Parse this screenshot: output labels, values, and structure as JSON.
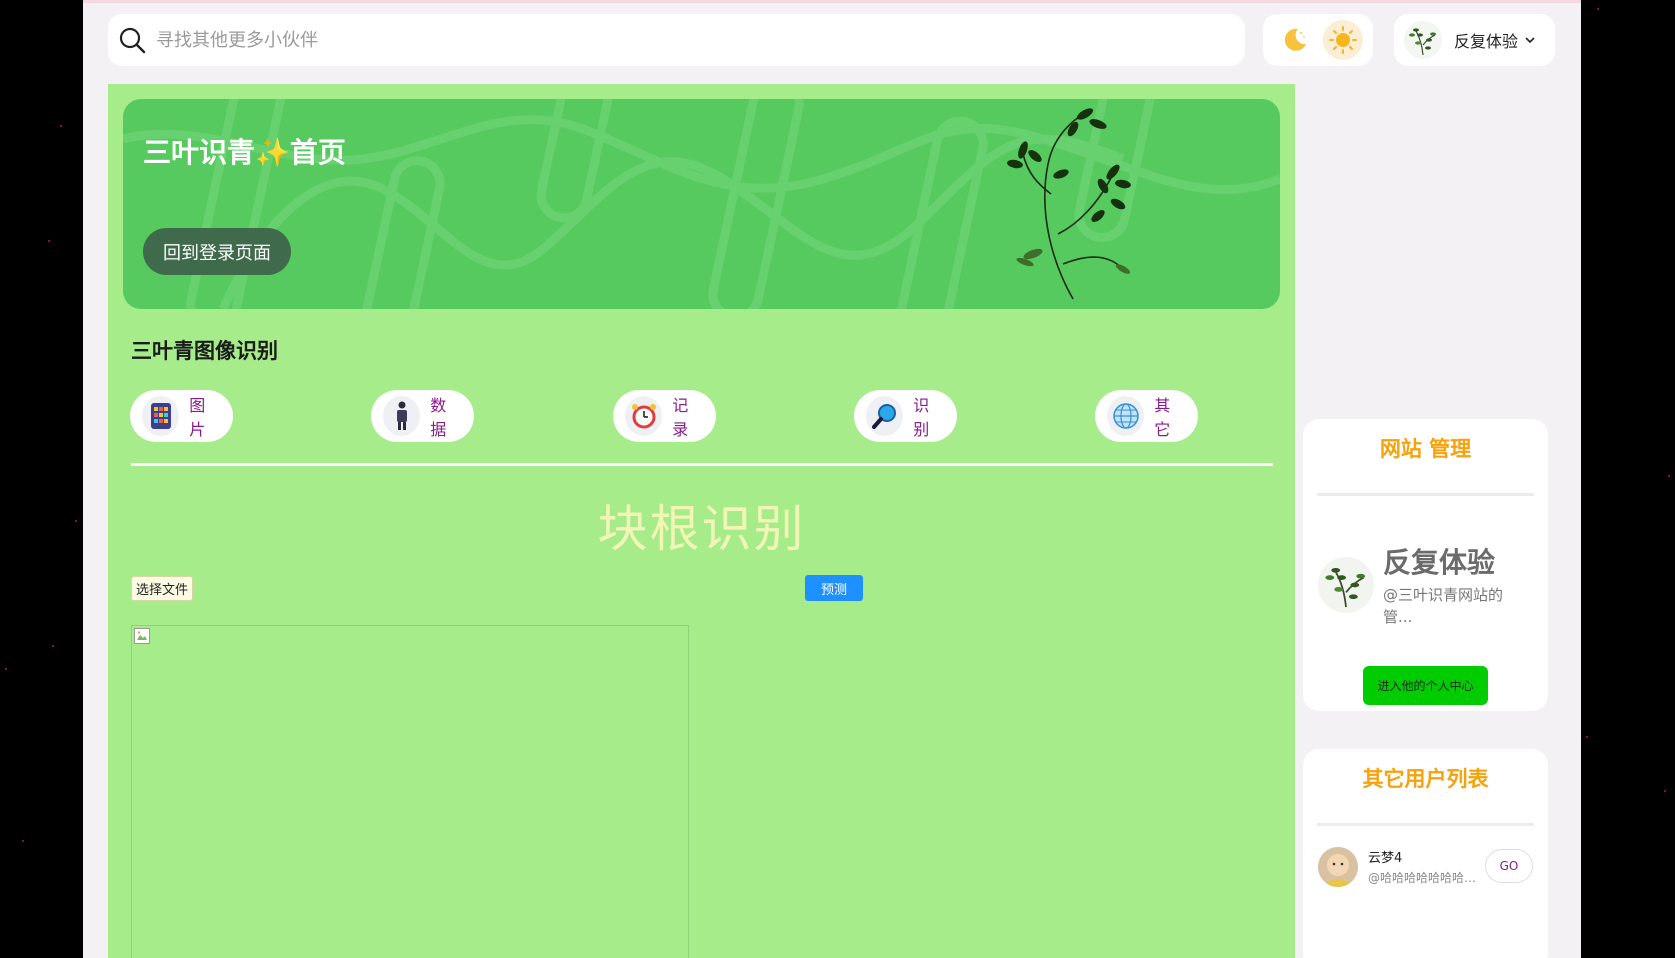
{
  "header": {
    "search_placeholder": "寻找其他更多小伙伴",
    "username": "反复体验"
  },
  "hero": {
    "title": "三叶识青✨首页",
    "back_button": "回到登录页面"
  },
  "section_title": "三叶青图像识别",
  "categories": [
    {
      "label": "图片",
      "icon": "calculator-icon"
    },
    {
      "label": "数据",
      "icon": "person-icon"
    },
    {
      "label": "记录",
      "icon": "alarm-clock-icon"
    },
    {
      "label": "识别",
      "icon": "magnifier-icon"
    },
    {
      "label": "其它",
      "icon": "globe-icon"
    }
  ],
  "page_heading": "块根识别",
  "file_button": "选择文件",
  "predict_button": "预测",
  "admin_panel": {
    "title": "网站 管理",
    "name": "反复体验",
    "handle": "@三叶识青网站的管...",
    "enter_button": "进入他的个人中心"
  },
  "users_panel": {
    "title": "其它用户列表",
    "users": [
      {
        "name": "云梦4",
        "handle": "@哈哈哈哈哈哈哈哈哈哈哈",
        "go": "GO"
      }
    ]
  },
  "colors": {
    "main_bg": "#a6ec8b",
    "hero_bg": "#56c95f",
    "accent_orange": "#f7a20a",
    "category_text": "#8b1a8f",
    "predict_blue": "#1e90ff",
    "enter_green": "#00cc00"
  }
}
